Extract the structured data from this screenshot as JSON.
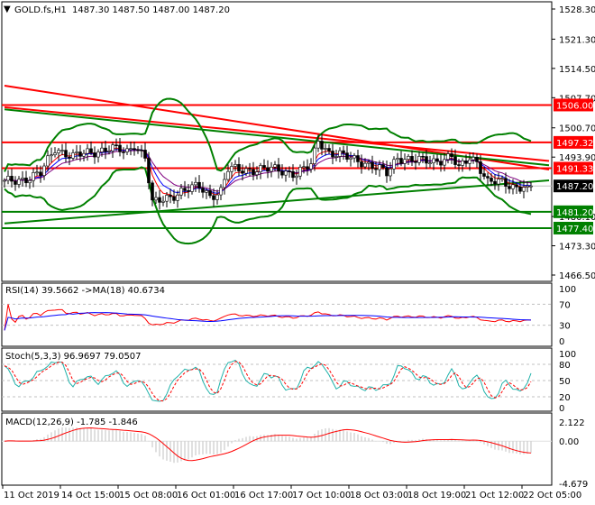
{
  "header": {
    "symbol": "GOLD.fs,H1",
    "ohlc": "1487.30 1487.50 1487.00 1487.20"
  },
  "chart_data": {
    "type": "candlestick",
    "symbol": "GOLD.fs",
    "timeframe": "H1",
    "ylim": [
      1466.5,
      1528.3
    ],
    "price_ticks": [
      "1528.30",
      "1521.30",
      "1514.50",
      "1507.70",
      "1500.70",
      "1493.90",
      "1480.10",
      "1473.30",
      "1466.50"
    ],
    "levels": [
      {
        "label": "1506.00",
        "price": 1506.0,
        "color": "#ff0000"
      },
      {
        "label": "1497.32",
        "price": 1497.32,
        "color": "#ff0000"
      },
      {
        "label": "1491.33",
        "price": 1491.33,
        "color": "#ff0000"
      },
      {
        "label": "1481.20",
        "price": 1481.2,
        "color": "#008000"
      },
      {
        "label": "1477.40",
        "price": 1477.4,
        "color": "#008000"
      }
    ],
    "current_price": {
      "label": "1487.20",
      "price": 1487.2,
      "color": "#000000"
    },
    "trendlines": [
      {
        "color": "#ff0000",
        "from": [
          0,
          1510.5
        ],
        "to": [
          151,
          1491.0
        ]
      },
      {
        "color": "#ff0000",
        "from": [
          0,
          1505.5
        ],
        "to": [
          151,
          1493.0
        ]
      },
      {
        "color": "#008000",
        "from": [
          0,
          1505.0
        ],
        "to": [
          151,
          1492.0
        ]
      },
      {
        "color": "#008000",
        "from": [
          0,
          1478.5
        ],
        "to": [
          151,
          1488.5
        ]
      }
    ],
    "close_keypoints": [
      [
        0,
        1488
      ],
      [
        6,
        1489
      ],
      [
        10,
        1490
      ],
      [
        14,
        1496
      ],
      [
        19,
        1494
      ],
      [
        24,
        1495
      ],
      [
        29,
        1496
      ],
      [
        34,
        1495
      ],
      [
        36,
        1497
      ],
      [
        39,
        1494
      ],
      [
        41,
        1483
      ],
      [
        44,
        1484
      ],
      [
        49,
        1486
      ],
      [
        54,
        1487
      ],
      [
        57,
        1485
      ],
      [
        60,
        1486
      ],
      [
        62,
        1491
      ],
      [
        66,
        1491
      ],
      [
        71,
        1491
      ],
      [
        76,
        1491
      ],
      [
        81,
        1490
      ],
      [
        85,
        1492
      ],
      [
        87,
        1498
      ],
      [
        90,
        1495
      ],
      [
        94,
        1494
      ],
      [
        99,
        1493
      ],
      [
        104,
        1491
      ],
      [
        106,
        1490
      ],
      [
        109,
        1494
      ],
      [
        114,
        1493
      ],
      [
        119,
        1493
      ],
      [
        124,
        1494
      ],
      [
        126,
        1491
      ],
      [
        129,
        1494
      ],
      [
        131,
        1493
      ],
      [
        134,
        1488
      ],
      [
        138,
        1488
      ],
      [
        142,
        1487
      ],
      [
        145,
        1487.2
      ]
    ],
    "time_labels": [
      {
        "label": "11 Oct 2019",
        "bar": 0
      },
      {
        "label": "14 Oct 15:00",
        "bar": 16
      },
      {
        "label": "15 Oct 08:00",
        "bar": 32
      },
      {
        "label": "16 Oct 01:00",
        "bar": 48
      },
      {
        "label": "16 Oct 17:00",
        "bar": 64
      },
      {
        "label": "17 Oct 10:00",
        "bar": 80
      },
      {
        "label": "18 Oct 03:00",
        "bar": 96
      },
      {
        "label": "18 Oct 19:00",
        "bar": 112
      },
      {
        "label": "21 Oct 12:00",
        "bar": 128
      },
      {
        "label": "22 Oct 05:00",
        "bar": 144
      }
    ],
    "indicators": {
      "rsi": {
        "title": "RSI(14) 39.5662  ->MA(18) 40.6734",
        "ticks": [
          "100",
          "70",
          "30",
          "0"
        ],
        "levels": [
          70,
          30
        ],
        "line_color": "#ff0000",
        "ma_color": "#0000ff"
      },
      "stoch": {
        "title": "Stoch(5,3,3) 96.9697 79.0507",
        "ticks": [
          "100",
          "80",
          "50",
          "20",
          "0"
        ],
        "levels": [
          80,
          50,
          20
        ],
        "main_color": "#20b2aa",
        "signal_color": "#ff0000"
      },
      "macd": {
        "title": "MACD(12,26,9) -1.785 -1.846",
        "ticks": [
          "2.122",
          "0.00",
          "-4.679"
        ],
        "range": [
          -4.679,
          2.122
        ],
        "hist_color": "#c0c0c0",
        "signal_color": "#ff0000"
      }
    }
  }
}
